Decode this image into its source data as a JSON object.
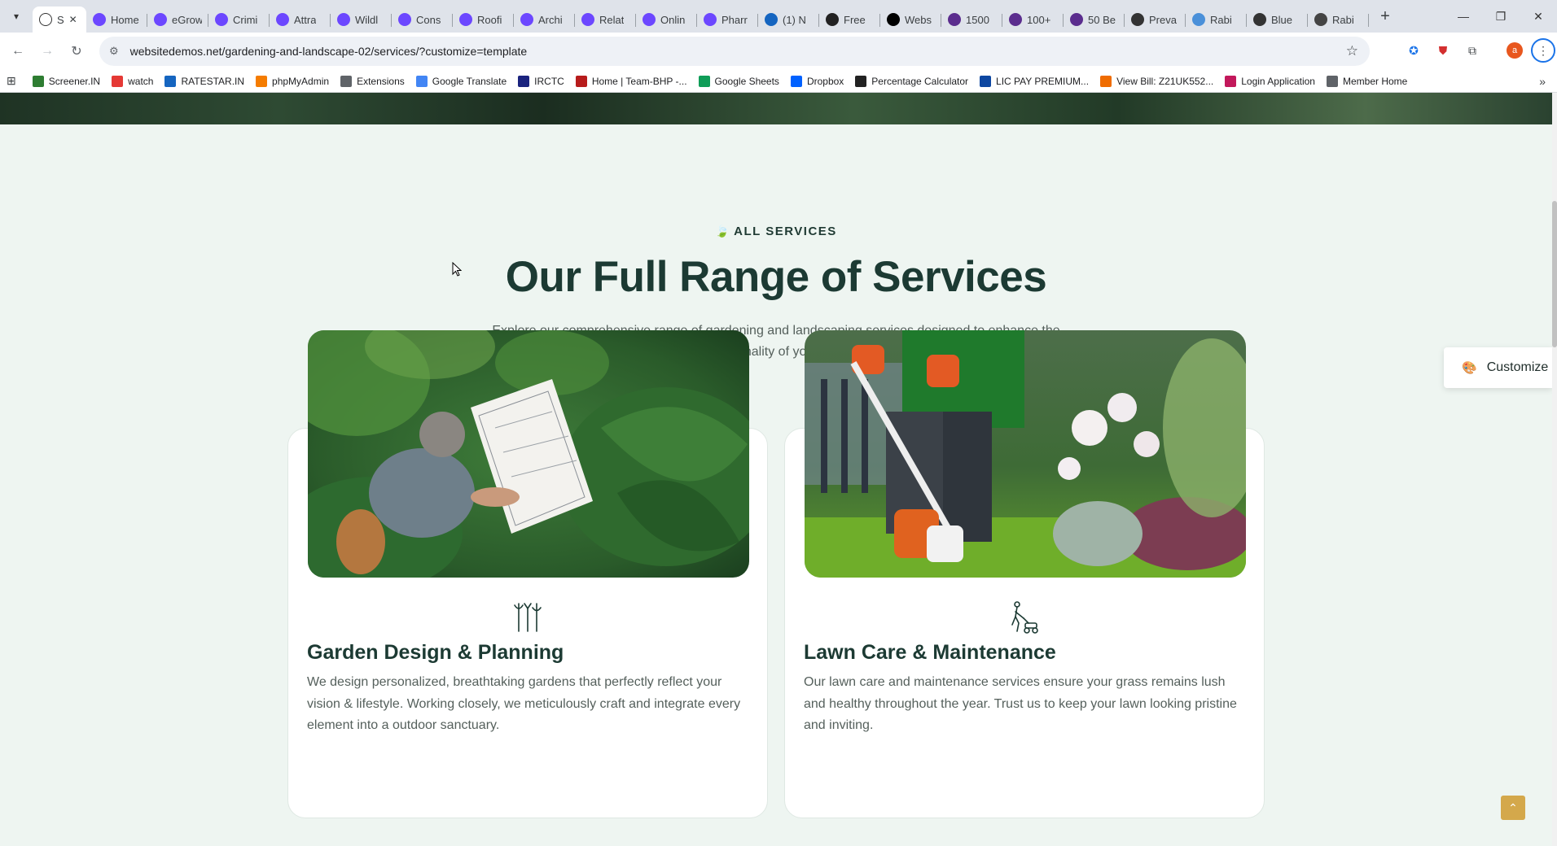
{
  "browser": {
    "tabs": [
      {
        "label": "S",
        "favicon_color": "#ffffff",
        "active": true
      },
      {
        "label": "Home",
        "favicon_color": "#6c47ff"
      },
      {
        "label": "eGrow",
        "favicon_color": "#6c47ff"
      },
      {
        "label": "Crimi",
        "favicon_color": "#6c47ff"
      },
      {
        "label": "Attra",
        "favicon_color": "#6c47ff"
      },
      {
        "label": "Wildl",
        "favicon_color": "#6c47ff"
      },
      {
        "label": "Cons",
        "favicon_color": "#6c47ff"
      },
      {
        "label": "Roofi",
        "favicon_color": "#6c47ff"
      },
      {
        "label": "Archi",
        "favicon_color": "#6c47ff"
      },
      {
        "label": "Relat",
        "favicon_color": "#6c47ff"
      },
      {
        "label": "Onlin",
        "favicon_color": "#6c47ff"
      },
      {
        "label": "Pharr",
        "favicon_color": "#6c47ff"
      },
      {
        "label": "(1) N",
        "favicon_color": "#1565c0"
      },
      {
        "label": "Free",
        "favicon_color": "#222222"
      },
      {
        "label": "Webs",
        "favicon_color": "#000000"
      },
      {
        "label": "1500",
        "favicon_color": "#5b2d8e"
      },
      {
        "label": "100+",
        "favicon_color": "#5b2d8e"
      },
      {
        "label": "50 Be",
        "favicon_color": "#5b2d8e"
      },
      {
        "label": "Preva",
        "favicon_color": "#333333"
      },
      {
        "label": "Rabi",
        "favicon_color": "#4a90d9"
      },
      {
        "label": "Blue",
        "favicon_color": "#333333"
      },
      {
        "label": "Rabi",
        "favicon_color": "#444444"
      }
    ],
    "url": "websitedemos.net/gardening-and-landscape-02/services/?customize=template",
    "bookmarks": [
      {
        "label": "Screener.IN",
        "color": "#2e7d32"
      },
      {
        "label": "watch",
        "color": "#e53935"
      },
      {
        "label": "RATESTAR.IN",
        "color": "#1565c0"
      },
      {
        "label": "phpMyAdmin",
        "color": "#f57c00"
      },
      {
        "label": "Extensions",
        "color": "#5f6368"
      },
      {
        "label": "Google Translate",
        "color": "#4285f4"
      },
      {
        "label": "IRCTC",
        "color": "#1a237e"
      },
      {
        "label": "Home | Team-BHP -...",
        "color": "#b71c1c"
      },
      {
        "label": "Google Sheets",
        "color": "#0f9d58"
      },
      {
        "label": "Dropbox",
        "color": "#0061ff"
      },
      {
        "label": "Percentage Calculator",
        "color": "#222222"
      },
      {
        "label": "LIC PAY PREMIUM...",
        "color": "#0d47a1"
      },
      {
        "label": "View Bill: Z21UK552...",
        "color": "#ef6c00"
      },
      {
        "label": "Login Application",
        "color": "#c2185b"
      },
      {
        "label": "Member Home",
        "color": "#5f6368"
      }
    ]
  },
  "page": {
    "eyebrow": "ALL SERVICES",
    "headline": "Our Full Range of Services",
    "subtext": "Explore our comprehensive range of gardening and landscaping services designed to enhance the beauty and functionality of your outdoor spaces.",
    "customize_label": "Customize",
    "services": [
      {
        "title": "Garden Design & Planning",
        "description": "We design personalized, breathtaking gardens that perfectly reflect your vision & lifestyle. Working closely, we meticulously craft and integrate every element into a outdoor sanctuary.",
        "icon": "garden-tools-icon"
      },
      {
        "title": "Lawn Care & Maintenance",
        "description": "Our lawn care and maintenance services ensure your grass remains lush and healthy throughout the year. Trust us to keep your lawn looking pristine and inviting.",
        "icon": "lawn-mower-icon"
      }
    ]
  },
  "colors": {
    "page_bg": "#eef5f1",
    "heading": "#1c3a33",
    "body_text": "#55605c",
    "accent_gold": "#d4a84b"
  }
}
